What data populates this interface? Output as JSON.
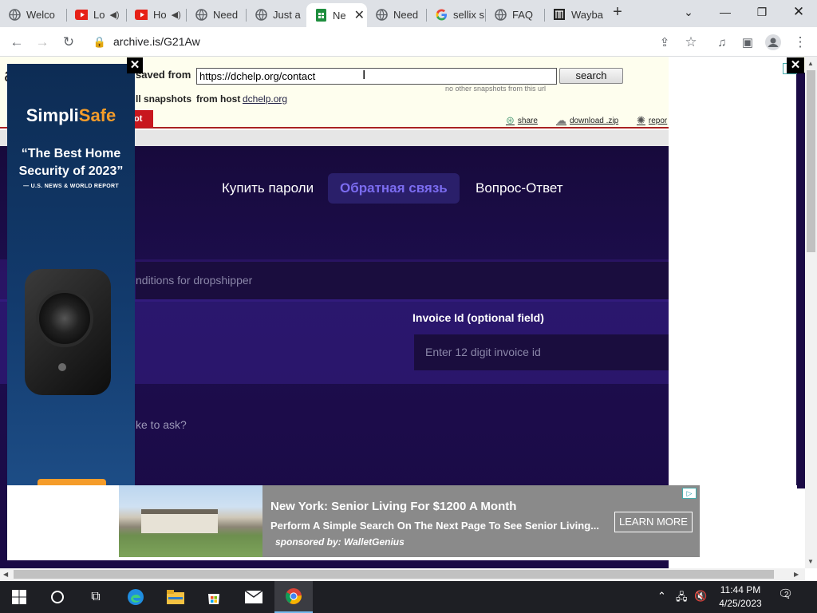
{
  "tabs": [
    {
      "title": "Welco",
      "icon": "globe-icon",
      "audio": false
    },
    {
      "title": "Lo",
      "icon": "youtube-icon",
      "audio": true
    },
    {
      "title": "Ho",
      "icon": "youtube-icon",
      "audio": true
    },
    {
      "title": "Need",
      "icon": "globe-icon",
      "audio": false
    },
    {
      "title": "Just a",
      "icon": "globe-icon",
      "audio": false
    },
    {
      "title": "Ne",
      "icon": "sheet-icon",
      "audio": false,
      "active": true
    },
    {
      "title": "Need",
      "icon": "globe-icon",
      "audio": false
    },
    {
      "title": "sellix s",
      "icon": "google-icon",
      "audio": false
    },
    {
      "title": "FAQ",
      "icon": "globe-icon",
      "audio": false
    },
    {
      "title": "Wayba",
      "icon": "wayback-icon",
      "audio": false
    }
  ],
  "toolbar": {
    "url": "archive.is/G21Aw"
  },
  "archive": {
    "saved_from_label": "saved from",
    "url_value": "https://dchelp.org/contact",
    "search_label": "search",
    "note": "no other snapshots from this url",
    "all_snapshots_label": "ll snapshots",
    "from_host_label": "from host",
    "host": "dchelp.org",
    "snapshot_btn": "ot",
    "share": "share",
    "download": "download .zip",
    "report": "repor"
  },
  "site": {
    "nav": [
      "Купить пароли",
      "Обратная связь",
      "Вопрос-Ответ"
    ],
    "select_text": "nditions for dropshipper",
    "invoice_label": "Invoice Id (optional field)",
    "invoice_placeholder": "Enter 12 digit invoice id",
    "ask_text": "ke to ask?"
  },
  "ad_left": {
    "brand_a": "Simpli",
    "brand_b": "Safe",
    "quote": "“The Best Home Security of 2023”",
    "source": "— U.S. NEWS & WORLD REPORT"
  },
  "ad_bottom": {
    "title": "New York: Senior Living For $1200 A Month",
    "desc": "Perform A Simple Search On The Next Page To See Senior Living...",
    "sponsor": "sponsored by: WalletGenius",
    "cta": "LEARN MORE"
  },
  "taskbar": {
    "time": "11:44 PM",
    "date": "4/25/2023",
    "notifications": "2"
  }
}
